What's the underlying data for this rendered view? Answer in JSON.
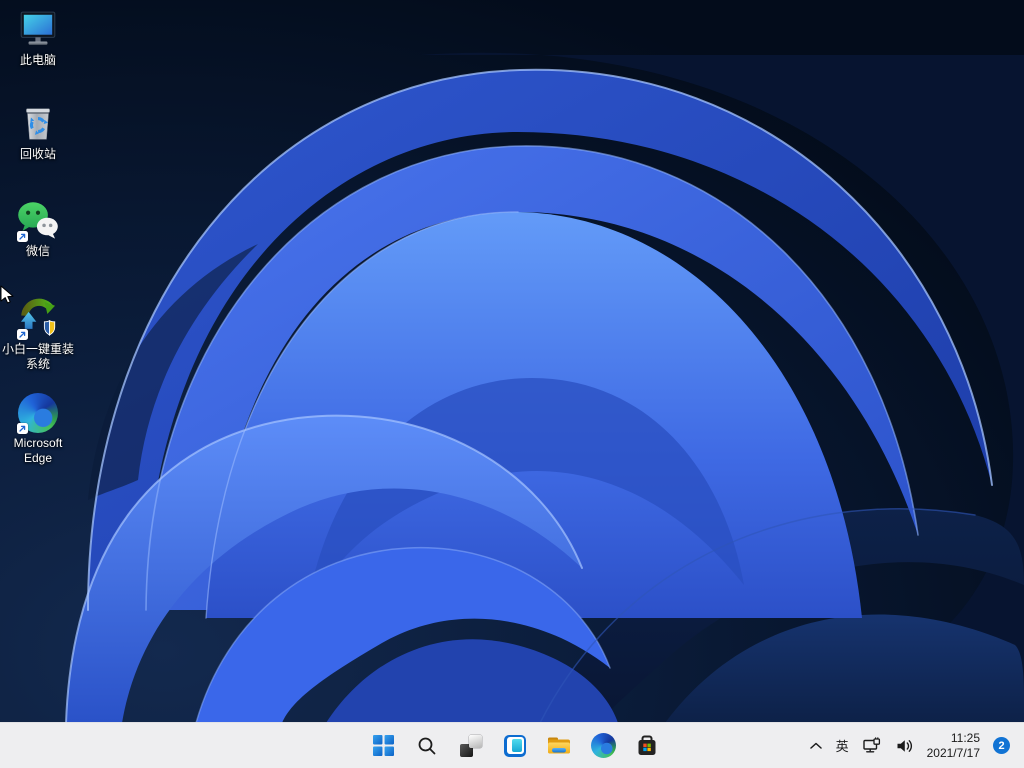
{
  "desktop": {
    "icons": [
      {
        "label": "此电脑"
      },
      {
        "label": "回收站"
      },
      {
        "label": "微信"
      },
      {
        "label": "小白一键重装系统"
      },
      {
        "label": "Microsoft Edge"
      }
    ]
  },
  "taskbar": {
    "tray": {
      "ime_label": "英",
      "time": "11:25",
      "date": "2021/7/17",
      "notification_count": "2"
    }
  },
  "colors": {
    "taskbar_bg": "#f3f3f5",
    "badge_blue": "#1173d4",
    "start_blue": "#1573d6",
    "wallpaper_dark": "#05101f",
    "wallpaper_bright_blue": "#3e6ef2",
    "wallpaper_rim": "#a6c4ff"
  }
}
